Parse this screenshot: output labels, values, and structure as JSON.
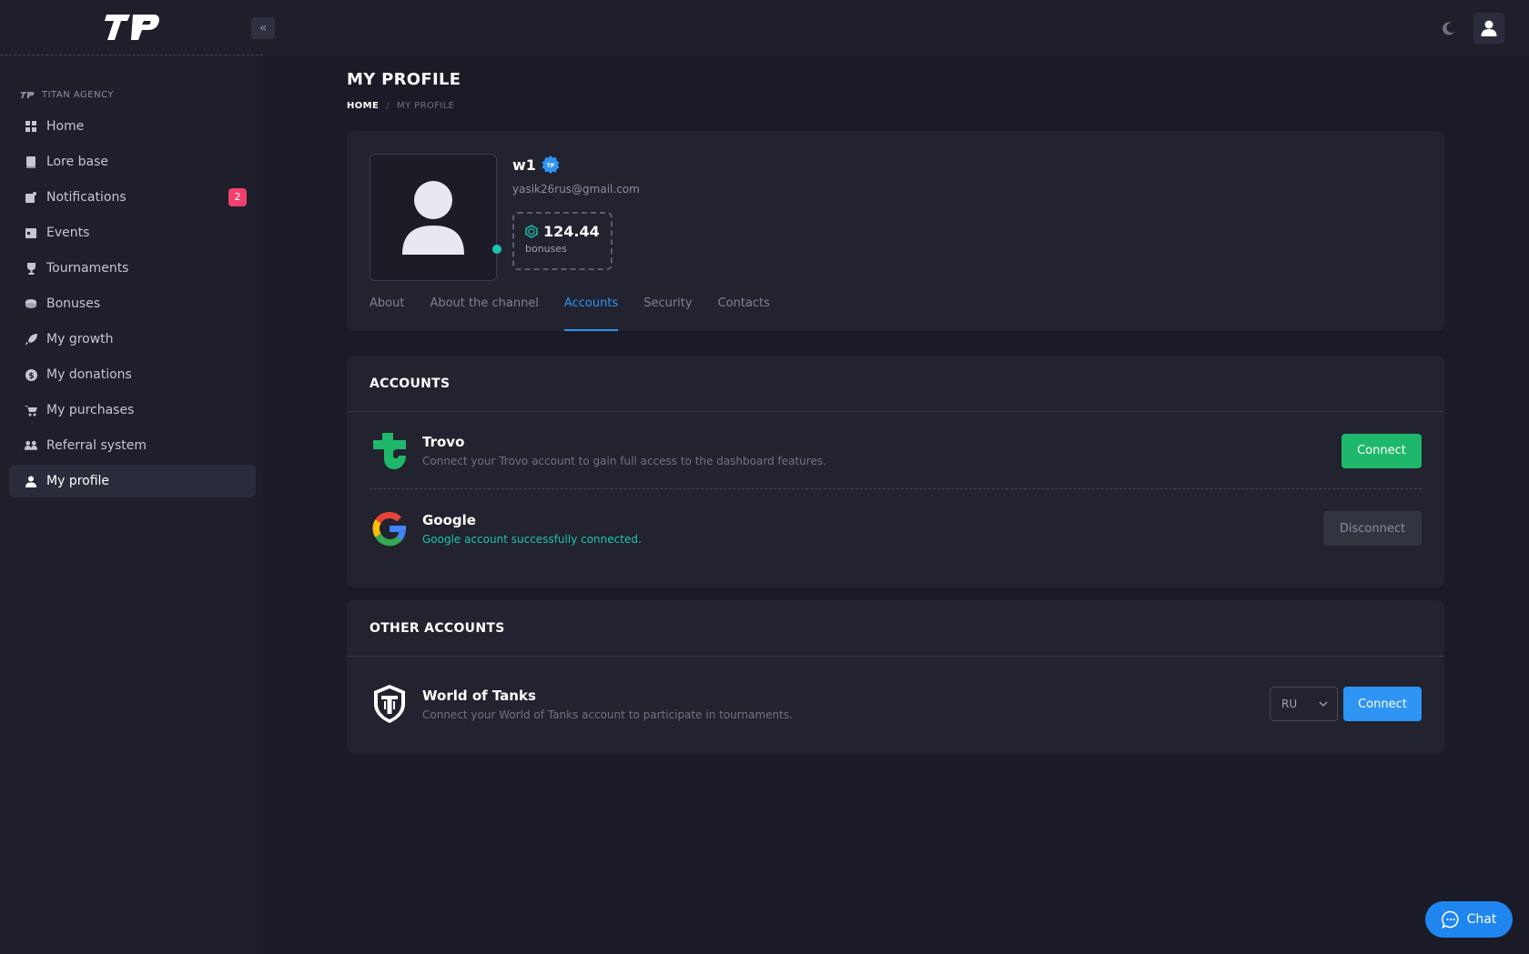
{
  "app": {
    "logo_text": "TP",
    "collapse_icon": "double-chevron-left-icon",
    "theme_icon": "moon-icon",
    "user_icon": "user-icon"
  },
  "sidebar": {
    "section": "TITAN AGENCY",
    "items": [
      {
        "label": "Home",
        "icon": "grid-icon"
      },
      {
        "label": "Lore base",
        "icon": "book-icon"
      },
      {
        "label": "Notifications",
        "icon": "notification-icon",
        "badge": "2"
      },
      {
        "label": "Events",
        "icon": "calendar-icon"
      },
      {
        "label": "Tournaments",
        "icon": "trophy-icon"
      },
      {
        "label": "Bonuses",
        "icon": "coins-icon"
      },
      {
        "label": "My growth",
        "icon": "rocket-icon"
      },
      {
        "label": "My donations",
        "icon": "dollar-icon"
      },
      {
        "label": "My purchases",
        "icon": "cart-icon"
      },
      {
        "label": "Referral system",
        "icon": "users-icon"
      },
      {
        "label": "My profile",
        "icon": "user-icon",
        "active": true
      }
    ]
  },
  "page": {
    "title": "MY PROFILE",
    "breadcrumb": {
      "home": "HOME",
      "separator": "/",
      "current": "MY PROFILE"
    }
  },
  "profile": {
    "username": "w1",
    "badge": "TP",
    "email": "yasik26rus@gmail.com",
    "bonus_value": "124.44",
    "bonus_label": "bonuses",
    "status_color": "#1ec3b0"
  },
  "tabs": [
    {
      "label": "About"
    },
    {
      "label": "About the channel"
    },
    {
      "label": "Accounts",
      "active": true
    },
    {
      "label": "Security"
    },
    {
      "label": "Contacts"
    }
  ],
  "accounts": {
    "title": "ACCOUNTS",
    "items": [
      {
        "name": "Trovo",
        "description": "Connect your Trovo account to gain full access to the dashboard features.",
        "button": "Connect",
        "color": "#1fb86a"
      },
      {
        "name": "Google",
        "description": "Google account successfully connected.",
        "button": "Disconnect"
      }
    ]
  },
  "other_accounts": {
    "title": "OTHER ACCOUNTS",
    "items": [
      {
        "name": "World of Tanks",
        "description": "Connect your World of Tanks account to participate in tournaments.",
        "region": "RU",
        "button": "Connect",
        "color": "#2e95f5"
      }
    ]
  },
  "chat": {
    "label": "Chat"
  }
}
